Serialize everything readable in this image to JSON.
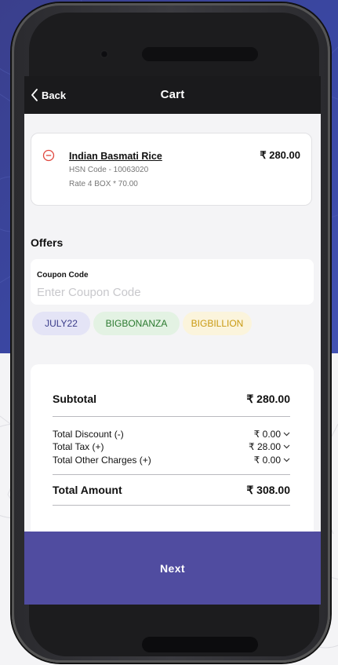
{
  "header": {
    "back_label": "Back",
    "title": "Cart"
  },
  "cart_item": {
    "name": "Indian Basmati Rice",
    "price": "₹ 280.00",
    "hsn": "HSN Code - 10063020",
    "rate": "Rate 4 BOX * 70.00"
  },
  "offers": {
    "title": "Offers",
    "coupon_label": "Coupon Code",
    "coupon_placeholder": "Enter Coupon Code",
    "coupon_value": "",
    "chips": [
      "JULY22",
      "BIGBONANZA",
      "BIGBILLION"
    ]
  },
  "summary": {
    "subtotal_label": "Subtotal",
    "subtotal_value": "₹ 280.00",
    "discount_label": "Total Discount (-)",
    "discount_value": "₹ 0.00",
    "tax_label": "Total Tax (+)",
    "tax_value": "₹ 28.00",
    "other_label": "Total Other Charges (+)",
    "other_value": "₹ 0.00",
    "total_label": "Total Amount",
    "total_value": "₹ 308.00"
  },
  "footer": {
    "next_label": "Next"
  },
  "colors": {
    "primary": "#504ca0",
    "app_bar": "#1a1a1c",
    "remove_icon": "#e0473e",
    "chip_july_text": "#3a3c8a",
    "chip_bonanza_text": "#2b7a2f",
    "chip_billion_text": "#c99a12"
  }
}
